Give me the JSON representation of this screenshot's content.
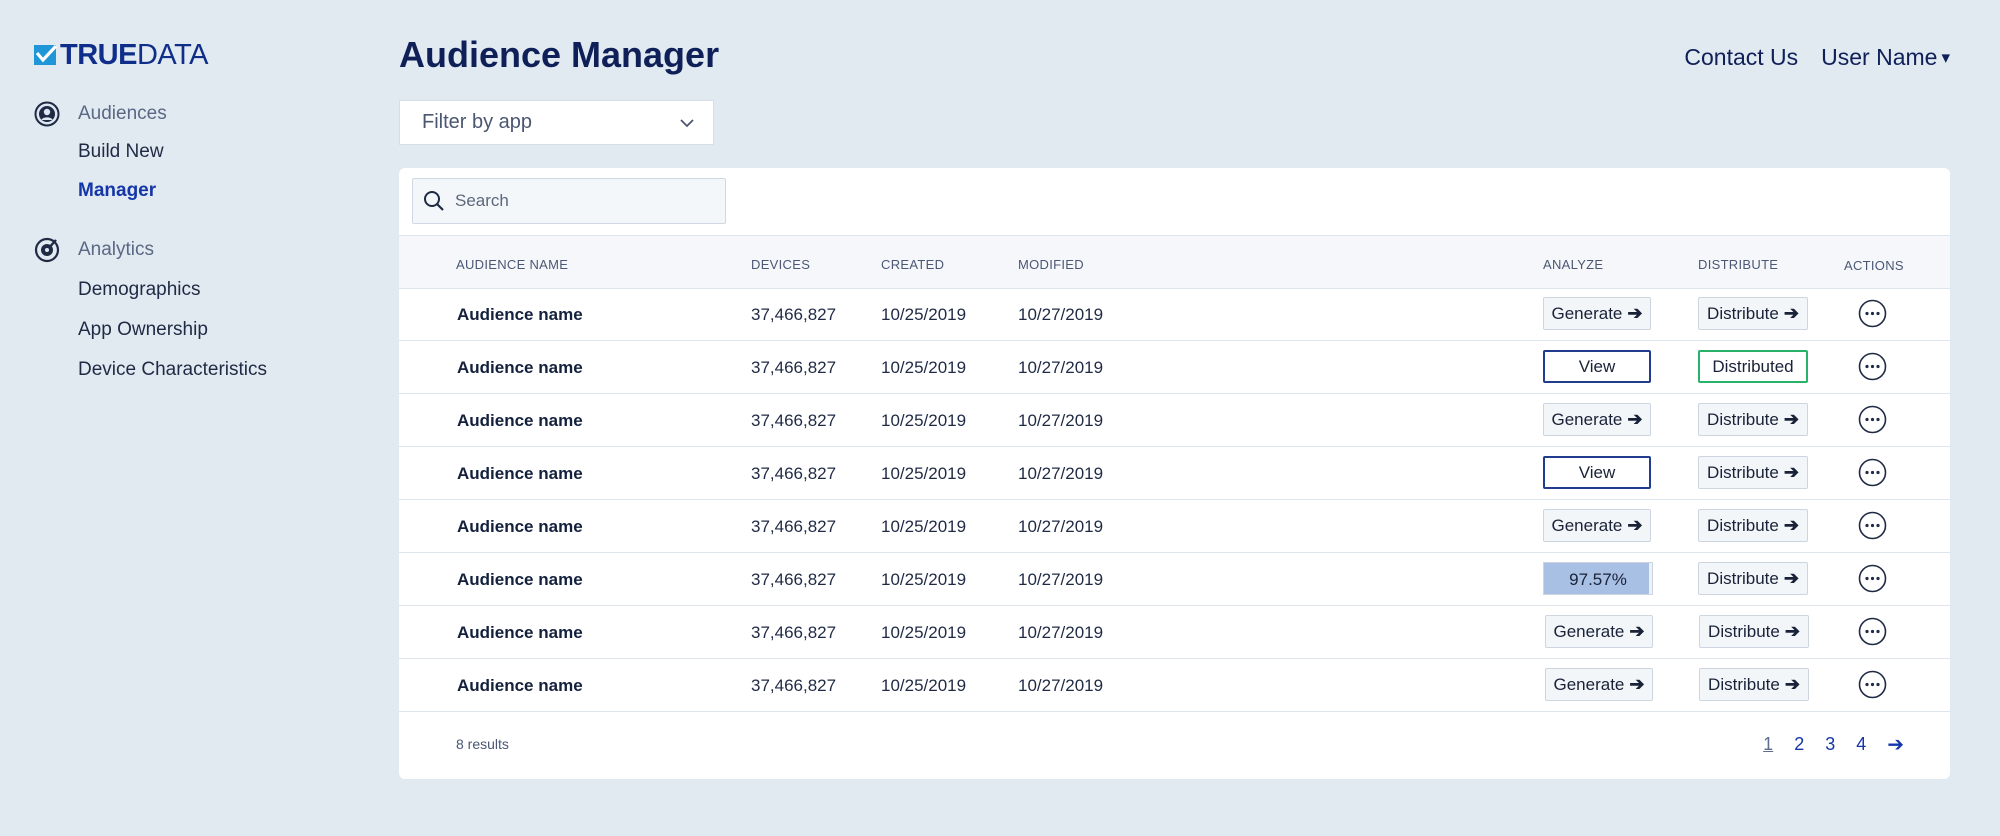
{
  "brand": {
    "logo_true": "TRUE",
    "logo_data": "DATA",
    "logo_color": "#0f2e8a",
    "logo_mark_color": "#1e96d8"
  },
  "sidebar": {
    "sections": [
      {
        "label": "Audiences",
        "icon": "user-circle-icon",
        "items": [
          {
            "label": "Build New",
            "active": false
          },
          {
            "label": "Manager",
            "active": true
          }
        ]
      },
      {
        "label": "Analytics",
        "icon": "target-gauge-icon",
        "items": [
          {
            "label": "Demographics",
            "active": false
          },
          {
            "label": "App Ownership",
            "active": false
          },
          {
            "label": "Device Characteristics",
            "active": false
          }
        ]
      }
    ]
  },
  "header": {
    "title": "Audience Manager",
    "contact_label": "Contact Us",
    "user_label": "User Name",
    "user_caret": "▾"
  },
  "filter": {
    "label": "Filter by app",
    "icon": "chevron-down-icon"
  },
  "search": {
    "placeholder": "Search",
    "icon": "search-icon"
  },
  "table": {
    "columns": {
      "name": "AUDIENCE NAME",
      "devices": "DEVICES",
      "created": "CREATED",
      "modified": "MODIFIED",
      "analyze": "ANALYZE",
      "distribute": "DISTRIBUTE",
      "actions": "ACTIONS"
    },
    "rows": [
      {
        "name": "Audience name",
        "devices": "37,466,827",
        "created": "10/25/2019",
        "modified": "10/27/2019",
        "analyze": {
          "kind": "generate",
          "label": "Generate"
        },
        "distribute": {
          "kind": "distribute",
          "label": "Distribute"
        }
      },
      {
        "name": "Audience name",
        "devices": "37,466,827",
        "created": "10/25/2019",
        "modified": "10/27/2019",
        "analyze": {
          "kind": "view",
          "label": "View"
        },
        "distribute": {
          "kind": "distributed",
          "label": "Distributed"
        }
      },
      {
        "name": "Audience name",
        "devices": "37,466,827",
        "created": "10/25/2019",
        "modified": "10/27/2019",
        "analyze": {
          "kind": "generate",
          "label": "Generate"
        },
        "distribute": {
          "kind": "distribute",
          "label": "Distribute"
        }
      },
      {
        "name": "Audience name",
        "devices": "37,466,827",
        "created": "10/25/2019",
        "modified": "10/27/2019",
        "analyze": {
          "kind": "view",
          "label": "View"
        },
        "distribute": {
          "kind": "distribute",
          "label": "Distribute"
        }
      },
      {
        "name": "Audience name",
        "devices": "37,466,827",
        "created": "10/25/2019",
        "modified": "10/27/2019",
        "analyze": {
          "kind": "generate",
          "label": "Generate"
        },
        "distribute": {
          "kind": "distribute",
          "label": "Distribute"
        }
      },
      {
        "name": "Audience name",
        "devices": "37,466,827",
        "created": "10/25/2019",
        "modified": "10/27/2019",
        "analyze": {
          "kind": "progress",
          "label": "97.57%",
          "progress_fraction": 0.9757
        },
        "distribute": {
          "kind": "distribute",
          "label": "Distribute"
        }
      },
      {
        "name": "Audience name",
        "devices": "37,466,827",
        "created": "10/25/2019",
        "modified": "10/27/2019",
        "analyze": {
          "kind": "generate",
          "label": "Generate"
        },
        "distribute": {
          "kind": "distribute",
          "label": "Distribute"
        }
      },
      {
        "name": "Audience name",
        "devices": "37,466,827",
        "created": "10/25/2019",
        "modified": "10/27/2019",
        "analyze": {
          "kind": "generate",
          "label": "Generate"
        },
        "distribute": {
          "kind": "distribute",
          "label": "Distribute"
        }
      }
    ],
    "arrow_glyph": "➔",
    "more_icon": "more-horizontal-icon"
  },
  "footer": {
    "results_text": "8 results",
    "pages": [
      "1",
      "2",
      "3",
      "4"
    ],
    "current_page": "1",
    "next_glyph": "➔"
  },
  "colors": {
    "background": "#e1e9f1",
    "primary": "#1436a8",
    "title": "#0f2058",
    "view_border": "#213b8f",
    "distributed_border": "#29b36a",
    "progress_fill": "#a8c0e4"
  }
}
